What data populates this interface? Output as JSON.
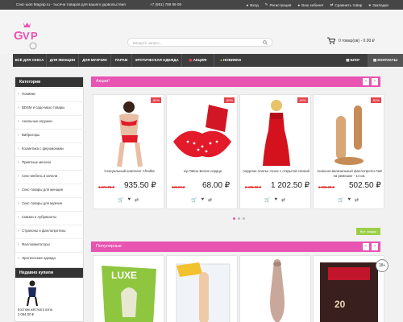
{
  "topbar": {
    "tagline": "Секс-шоп Magvip.ru - тысячи товаров для вашего удовольствия",
    "phone": "+7 (951) 789 99 09",
    "links": [
      "Вход",
      "Регистрация",
      "Ваш кабинет",
      "Сравнить товар",
      "Закладки"
    ]
  },
  "header": {
    "search_placeholder": "Введите запрос...",
    "cart": "0 товар(ов) - 0.00 ₽"
  },
  "nav": {
    "items": [
      "ВСЁ ДЛЯ СЕКСА",
      "ДЛЯ ЖЕНЩИН",
      "ДЛЯ МУЖЧИН",
      "ПАРАМ",
      "ЭРОТИЧЕСКАЯ ОДЕЖДА",
      "АКЦИЯ!",
      "НОВИНКИ"
    ],
    "blog": "БЛОГ",
    "contacts": "КОНТАКТЫ"
  },
  "sidebar": {
    "title": "Категории",
    "items": [
      "Новинки",
      "BDSM и садо-мазо товары",
      "Анальные игрушки",
      "Вибраторы",
      "Косметика с феромонами",
      "Приятные мелочи",
      "Секс-мебель и качели",
      "Секс-товары для женщин",
      "Секс-товары для мужчин",
      "Смазки и лубриканты",
      "Страпоны и фаллопротезы",
      "Фаллоимитаторы",
      "Эротическая одежда"
    ]
  },
  "recent": {
    "title": "Недавно купили",
    "name": "Костюм жёсткого копа",
    "price": "3 084.00 ₽"
  },
  "sales": {
    "title": "Акции!",
    "all": "Все скидки",
    "items": [
      {
        "badge": "-50%",
        "name": "Сексуальный комплект Afrodita",
        "old": "1 871.00 ₽",
        "price": "935.50 ₽"
      },
      {
        "badge": "-50%",
        "name": "Lip Tattoo Белое сердце",
        "old": "136.00 ₽",
        "price": "68.00 ₽"
      },
      {
        "badge": "-50%",
        "name": "Ажурное платье Azure с открытой спиной",
        "old": "2 405.00 ₽",
        "price": "1 202.50 ₽"
      },
      {
        "badge": "-50%",
        "name": "Анально-вагинальный фаллопротез №8 на ремешке - 14 см.",
        "old": "1 005.00 ₽",
        "price": "502.50 ₽"
      }
    ]
  },
  "popular": {
    "title": "Популярные",
    "age": "18+"
  },
  "colors": {
    "accent": "#e754b2",
    "dark": "#3d3d3d",
    "badge": "#e4454d",
    "green": "#9bcf4a"
  }
}
